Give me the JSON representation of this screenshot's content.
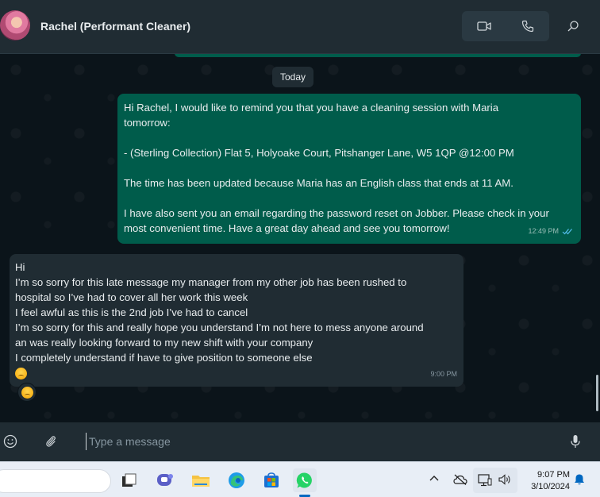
{
  "header": {
    "contact_name": "Rachel (Performant Cleaner)"
  },
  "chat": {
    "date_divider": "Today",
    "outgoing": {
      "lines": [
        "Hi Rachel, I would like to remind you that you have a cleaning session with Maria",
        "tomorrow:",
        "",
        "- (Sterling Collection) Flat 5, Holyoake Court, Pitshanger Lane, W5 1QP @12:00 PM",
        "",
        "The time has been updated because Maria has an English class that ends at 11 AM.",
        "",
        "I have also sent you an email regarding the password reset on Jobber. Please check in your",
        "most convenient time. Have a great day ahead and see you tomorrow!"
      ],
      "time": "12:49 PM",
      "status": "read"
    },
    "incoming": {
      "lines": [
        "Hi",
        "I’m so sorry for this late message my manager from my other job has been rushed to",
        "hospital so I’ve had to cover all her work this week",
        "I feel awful as this is the 2nd job I’ve had to cancel",
        "I’m so sorry for this and really hope you understand I’m not here to mess anyone around",
        "an was really looking forward to my new shift with your company",
        "I completely understand if have to give position to someone else"
      ],
      "emoji": "disappointed-face",
      "time": "9:00 PM",
      "reaction": "disappointed-face"
    }
  },
  "composer": {
    "placeholder": "Type a message"
  },
  "taskbar": {
    "apps": [
      "file-explorer-icon",
      "teams-icon",
      "folder-icon",
      "edge-icon",
      "store-icon",
      "whatsapp-icon"
    ],
    "clock_time": "9:07 PM",
    "clock_date": "3/10/2024"
  },
  "colors": {
    "outgoing_bubble": "#005c4b",
    "incoming_bubble": "#202c33",
    "chat_background": "#0b141a",
    "read_ticks": "#53bdeb"
  }
}
